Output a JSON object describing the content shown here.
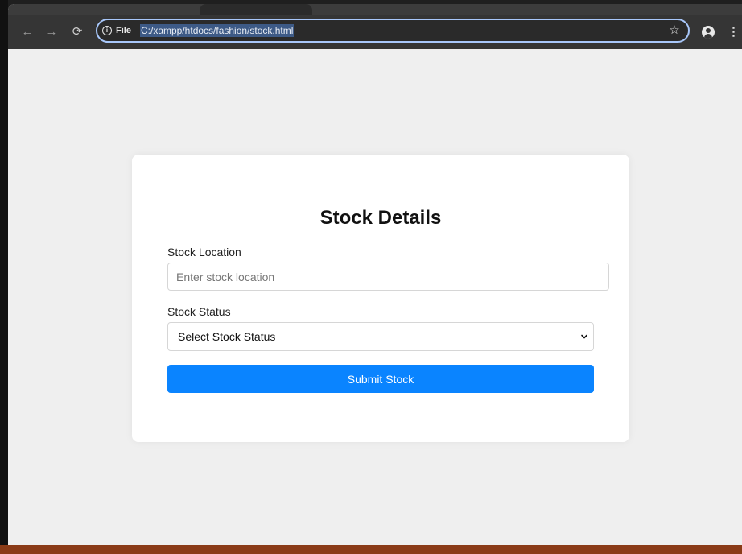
{
  "browser": {
    "site_chip_label": "File",
    "url": "C:/xampp/htdocs/fashion/stock.html",
    "icons": {
      "back": "arrow-left",
      "forward": "arrow-right",
      "reload": "reload",
      "info": "info-circle",
      "bookmark": "star",
      "profile": "person",
      "menu": "three-dots-vertical"
    },
    "colors": {
      "omnibox_border": "#a8c7fa",
      "toolbar": "#353535"
    }
  },
  "form": {
    "title": "Stock Details",
    "location": {
      "label": "Stock Location",
      "placeholder": "Enter stock location",
      "value": ""
    },
    "status": {
      "label": "Stock Status",
      "selected": "Select Stock Status"
    },
    "submit_label": "Submit Stock"
  },
  "colors": {
    "page_background": "#efefef",
    "card_background": "#ffffff",
    "accent": "#0a84ff",
    "status_bar": "#8a3b17"
  }
}
